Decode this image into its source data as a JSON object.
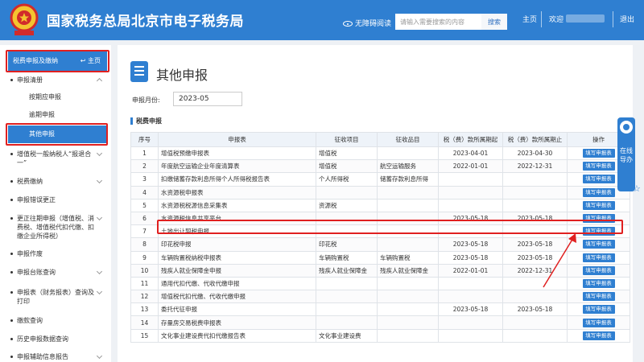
{
  "header": {
    "title": "国家税务总局北京市电子税务局",
    "accessible_label": "无障碍阅读",
    "search_placeholder": "请输入需要搜索的内容",
    "search_button": "搜索",
    "home_link": "主页",
    "welcome_label": "欢迎",
    "logout_link": "退出",
    "brand_color": "#2f7fd1"
  },
  "sidebar": {
    "head_label": "税费申报及缴纳",
    "head_home": "主页",
    "items": [
      {
        "label": "申报清册"
      },
      {
        "label": "按期应申报"
      },
      {
        "label": "逾期申报"
      },
      {
        "label": "其他申报"
      },
      {
        "label": "增值税一般纳税人“报退合一”"
      },
      {
        "label": "税费缴纳"
      },
      {
        "label": "申报错误更正"
      },
      {
        "label": "更正往期申报（增值税、消费税、增值税代扣代缴、扣缴企业所得税）"
      },
      {
        "label": "申报作废"
      },
      {
        "label": "申报台账查询"
      },
      {
        "label": "申报表（财务报表）查询及打印"
      },
      {
        "label": "缴款查询"
      },
      {
        "label": "历史申报数据查询"
      },
      {
        "label": "申报辅助信息报告"
      }
    ]
  },
  "main": {
    "page_title": "其他申报",
    "month_label": "申报月份:",
    "month_value": "2023-05",
    "section_label": "税费申报",
    "columns": [
      "序号",
      "申报表",
      "征收项目",
      "征收品目",
      "税（费）款所属期起",
      "税（费）款所属期止",
      "操作"
    ],
    "button_label": "填写申报表",
    "rows": [
      {
        "no": "1",
        "form": "增值税预缴申报表",
        "item": "增值税",
        "sub": "",
        "start": "2023-04-01",
        "end": "2023-04-30"
      },
      {
        "no": "2",
        "form": "年度航空运输企业年度清算表",
        "item": "增值税",
        "sub": "航空运输服务",
        "start": "2022-01-01",
        "end": "2022-12-31"
      },
      {
        "no": "3",
        "form": "扣缴储蓄存款利息所得个人所得税报告表",
        "item": "个人所得税",
        "sub": "储蓄存款利息所得",
        "start": "",
        "end": ""
      },
      {
        "no": "4",
        "form": "水资源税申报表",
        "item": "",
        "sub": "",
        "start": "",
        "end": ""
      },
      {
        "no": "5",
        "form": "水资源税税源信息采集表",
        "item": "资源税",
        "sub": "",
        "start": "",
        "end": ""
      },
      {
        "no": "6",
        "form": "水资源税信息共享平台",
        "item": "",
        "sub": "",
        "start": "2023-05-18",
        "end": "2023-05-18"
      },
      {
        "no": "7",
        "form": "土地出让契税申报",
        "item": "",
        "sub": "",
        "start": "",
        "end": ""
      },
      {
        "no": "8",
        "form": "印花税申报",
        "item": "印花税",
        "sub": "",
        "start": "2023-05-18",
        "end": "2023-05-18"
      },
      {
        "no": "9",
        "form": "车辆购置税纳税申报表",
        "item": "车辆购置税",
        "sub": "车辆购置税",
        "start": "2023-05-18",
        "end": "2023-05-18"
      },
      {
        "no": "10",
        "form": "残疾人就业保障金申报",
        "item": "残疾人就业保障金",
        "sub": "残疾人就业保障金",
        "start": "2022-01-01",
        "end": "2022-12-31"
      },
      {
        "no": "11",
        "form": "通用代扣代缴、代收代缴申报",
        "item": "",
        "sub": "",
        "start": "",
        "end": ""
      },
      {
        "no": "12",
        "form": "增值税代扣代缴、代收代缴申报",
        "item": "",
        "sub": "",
        "start": "",
        "end": ""
      },
      {
        "no": "13",
        "form": "委托代征申报",
        "item": "",
        "sub": "",
        "start": "2023-05-18",
        "end": "2023-05-18"
      },
      {
        "no": "14",
        "form": "存量房交易税费申报表",
        "item": "",
        "sub": "",
        "start": "",
        "end": ""
      },
      {
        "no": "15",
        "form": "文化事业建设费代扣代缴报告表",
        "item": "文化事业建设费",
        "sub": "",
        "start": "",
        "end": ""
      }
    ]
  },
  "float_help": {
    "label": "在线导办"
  },
  "annotation_color": "#e02020"
}
